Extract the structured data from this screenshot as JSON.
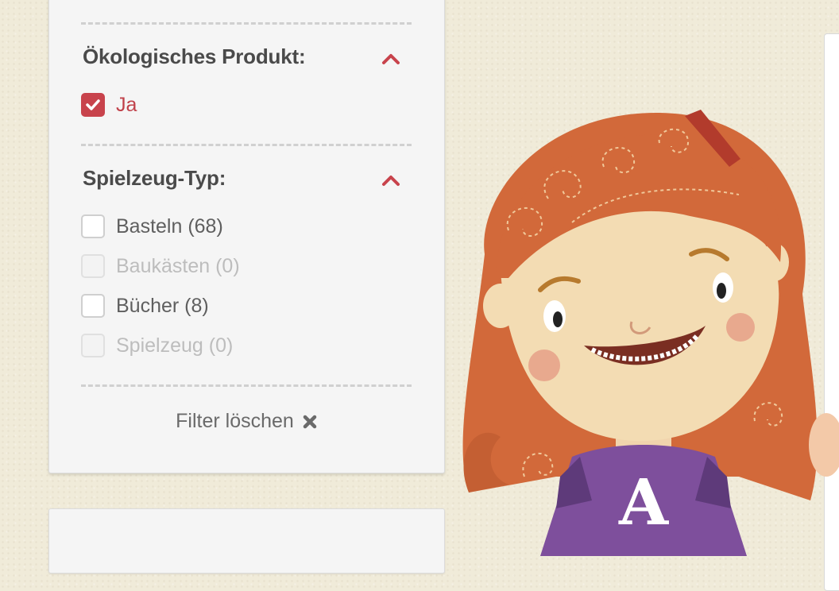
{
  "filters": {
    "eco": {
      "title": "Ökologisches Produkt:",
      "options": [
        {
          "label": "Ja",
          "checked": true
        }
      ]
    },
    "toy_type": {
      "title": "Spielzeug-Typ:",
      "options": [
        {
          "label": "Basteln (68)",
          "enabled": true
        },
        {
          "label": "Baukästen (0)",
          "enabled": false
        },
        {
          "label": "Bücher (8)",
          "enabled": true
        },
        {
          "label": "Spielzeug (0)",
          "enabled": false
        }
      ]
    },
    "clear_label": "Filter löschen"
  },
  "illustration": {
    "shirt_letter": "A"
  },
  "colors": {
    "accent": "#c8434c",
    "panel_bg": "#f5f5f5",
    "page_bg": "#f0ebd9",
    "hair": "#d2693a",
    "shirt": "#7e4f9c"
  }
}
